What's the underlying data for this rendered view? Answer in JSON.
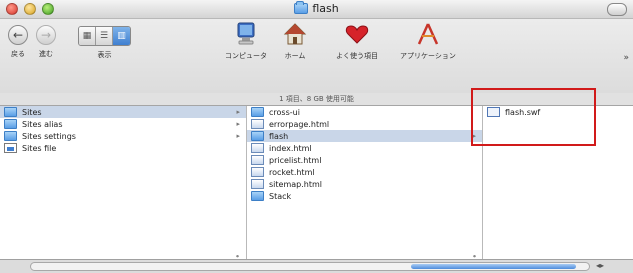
{
  "window": {
    "title": "flash"
  },
  "toolbar": {
    "back_label": "戻る",
    "forward_label": "進む",
    "view_label": "表示",
    "computer_label": "コンピュータ",
    "home_label": "ホーム",
    "favorites_label": "よく使う項目",
    "applications_label": "アプリケーション"
  },
  "pathbar": {
    "text": "1 項目、8 GB 使用可能"
  },
  "columns": {
    "col1": [
      {
        "label": "Sites",
        "kind": "folder",
        "selected": true,
        "arrow": "▸"
      },
      {
        "label": "Sites alias",
        "kind": "folder",
        "selected": false,
        "arrow": "▸"
      },
      {
        "label": "Sites settings",
        "kind": "folder",
        "selected": false,
        "arrow": "▸"
      },
      {
        "label": "Sites file",
        "kind": "doc",
        "selected": false,
        "arrow": ""
      }
    ],
    "col2": [
      {
        "label": "cross-ui",
        "kind": "folder",
        "selected": false,
        "arrow": ""
      },
      {
        "label": "errorpage.html",
        "kind": "web",
        "selected": false,
        "arrow": ""
      },
      {
        "label": "flash",
        "kind": "folder",
        "selected": true,
        "arrow": "▸"
      },
      {
        "label": "index.html",
        "kind": "web",
        "selected": false,
        "arrow": ""
      },
      {
        "label": "pricelist.html",
        "kind": "web",
        "selected": false,
        "arrow": ""
      },
      {
        "label": "rocket.html",
        "kind": "web",
        "selected": false,
        "arrow": ""
      },
      {
        "label": "sitemap.html",
        "kind": "web",
        "selected": false,
        "arrow": ""
      },
      {
        "label": "Stack",
        "kind": "folder",
        "selected": false,
        "arrow": ""
      }
    ],
    "col3": [
      {
        "label": "flash.swf",
        "kind": "swf",
        "selected": false,
        "arrow": ""
      }
    ]
  },
  "colors": {
    "highlight_box": "#d11a1a",
    "selection": "#c9d6e8"
  }
}
